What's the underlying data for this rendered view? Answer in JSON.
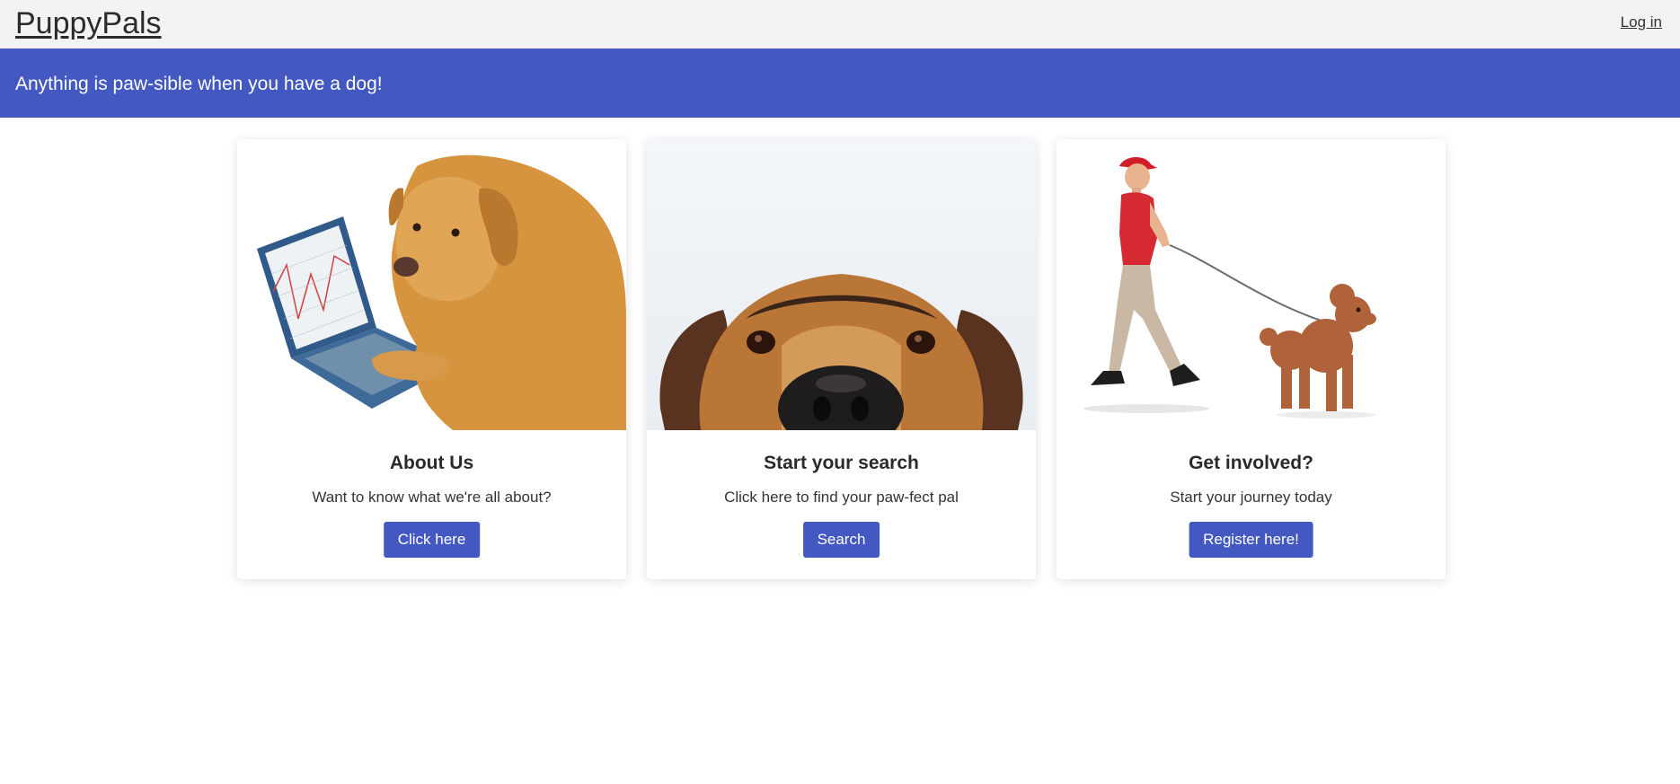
{
  "navbar": {
    "brand": "PuppyPals",
    "login_label": "Log in"
  },
  "banner": {
    "tagline": "Anything is paw-sible when you have a dog!"
  },
  "cards": [
    {
      "title": "About Us",
      "text": "Want to know what we're all about?",
      "button": "Click here",
      "image": "dog-with-laptop"
    },
    {
      "title": "Start your search",
      "text": "Click here to find your paw-fect pal",
      "button": "Search",
      "image": "dog-peeking"
    },
    {
      "title": "Get involved?",
      "text": "Start your journey today",
      "button": "Register here!",
      "image": "man-walking-poodle"
    }
  ],
  "colors": {
    "accent": "#4358c0",
    "navbar_bg": "#f3f3f3"
  }
}
